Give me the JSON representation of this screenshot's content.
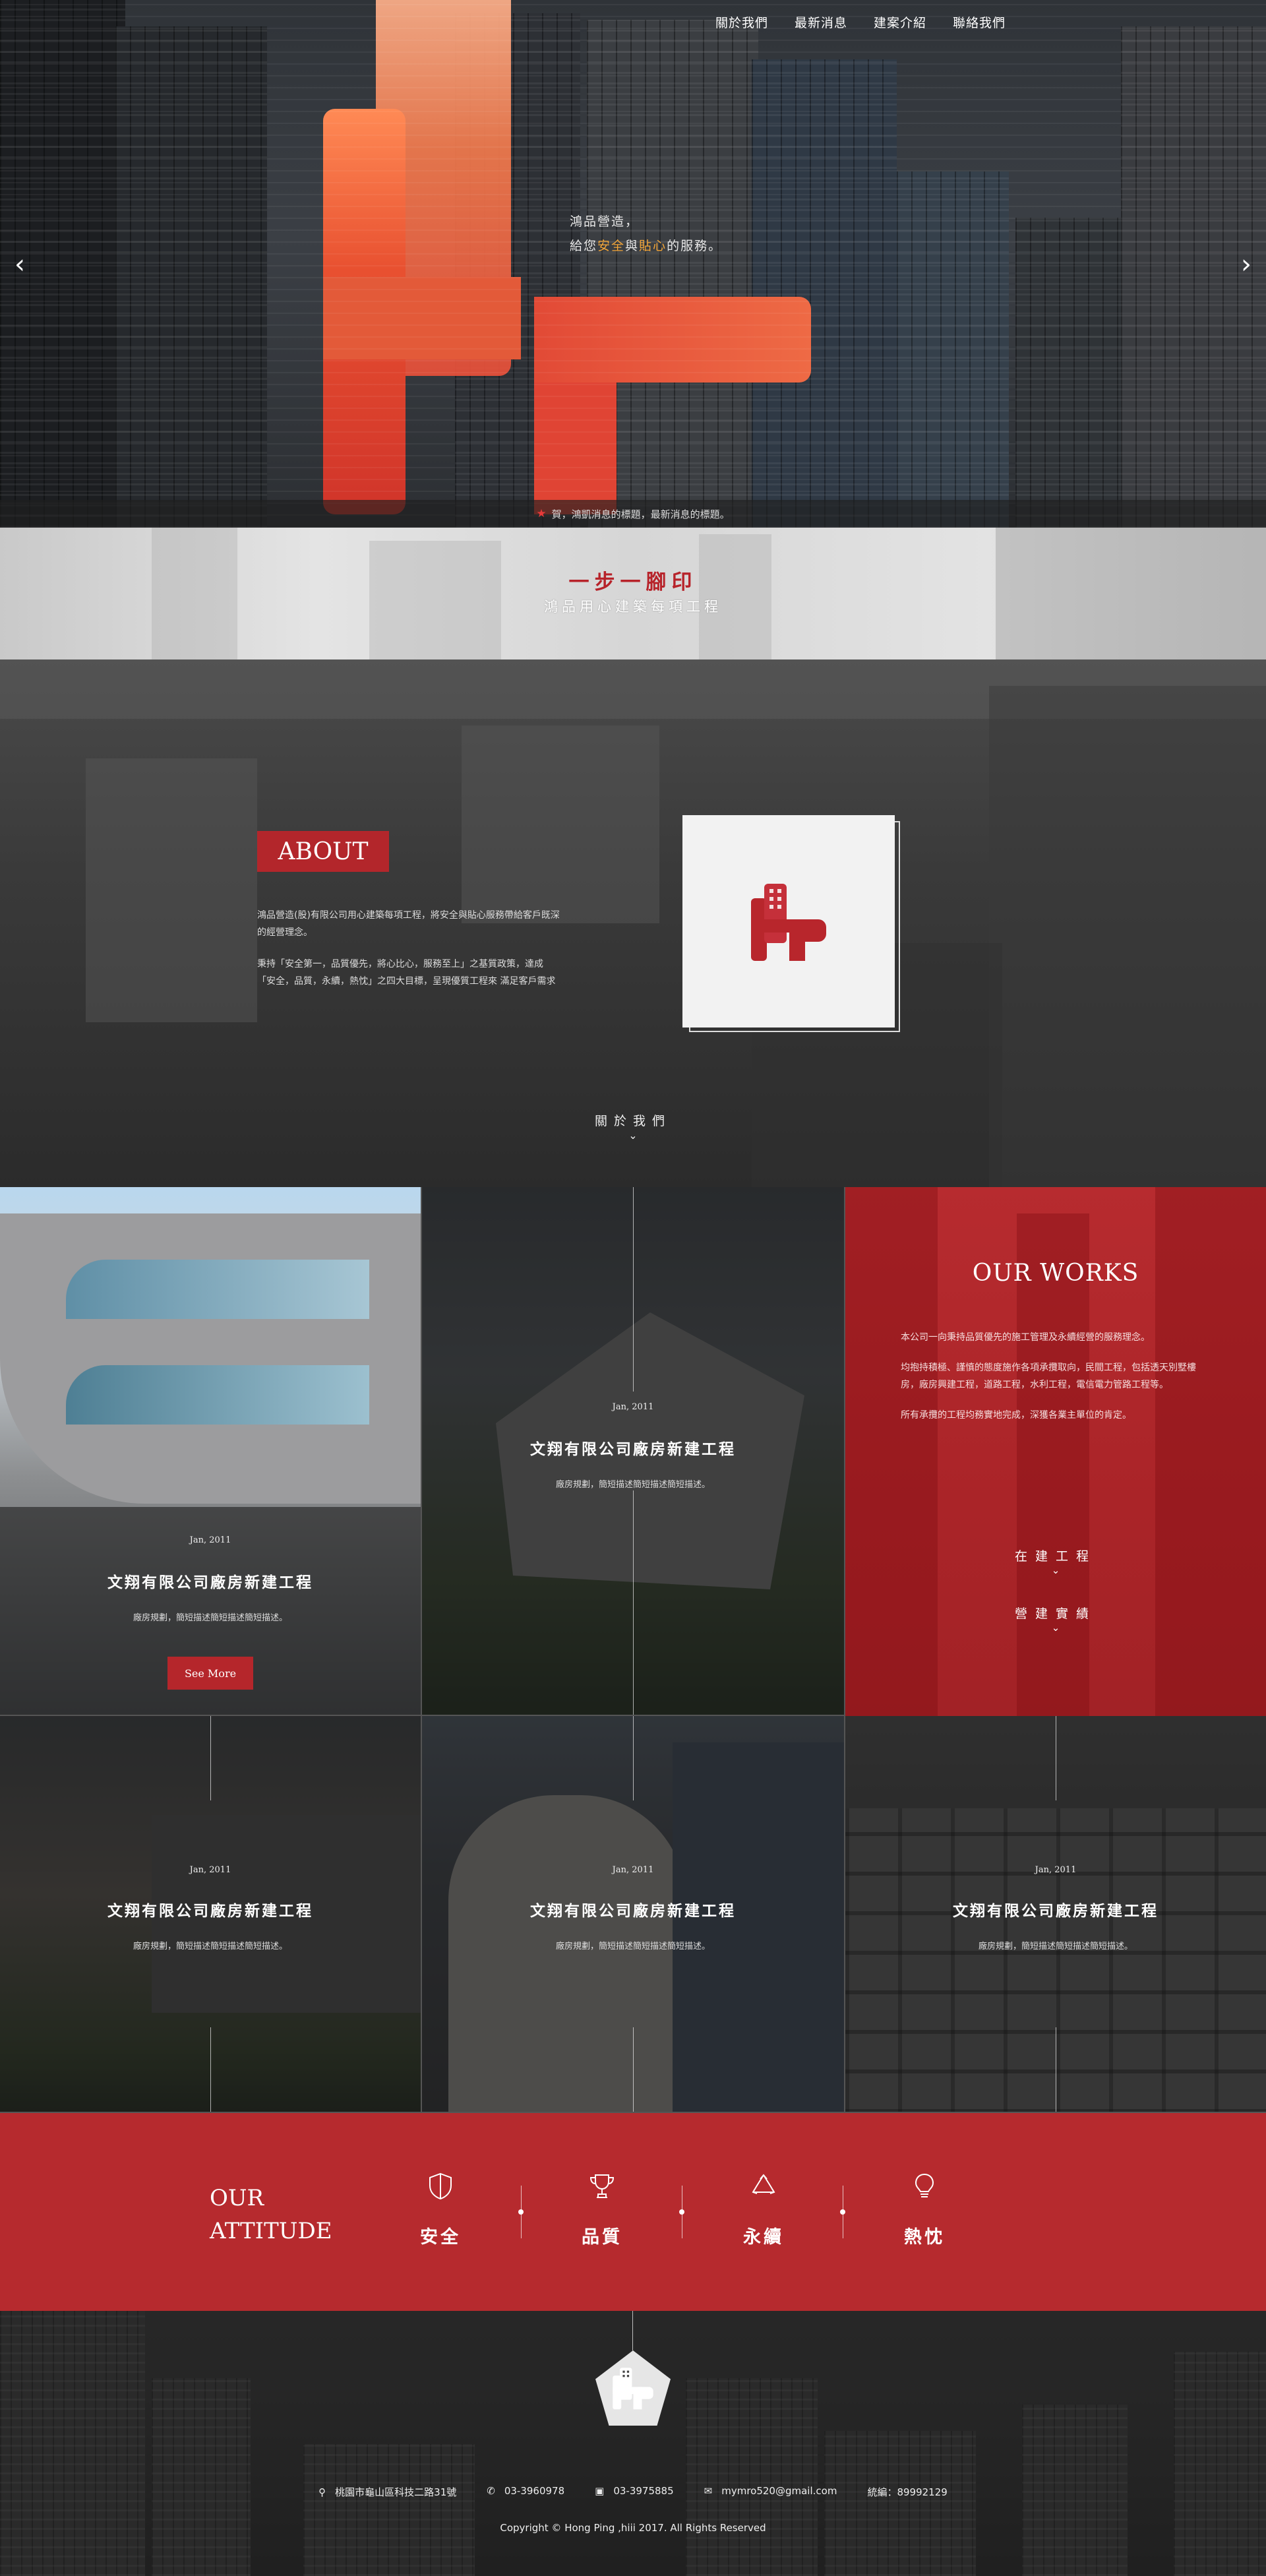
{
  "nav": {
    "items": [
      "關於我們",
      "最新消息",
      "建案介紹",
      "聯絡我們"
    ],
    "prev_arrow": "‹",
    "next_arrow": "›"
  },
  "hero": {
    "tagline_line1": "鴻品營造，",
    "tagline_line2_a": "給您",
    "tagline_line2_safe": "安全",
    "tagline_line2_and": "與",
    "tagline_line2_care": "貼心",
    "tagline_line2_b": "的服務。",
    "news": "賀，鴻凱消息的標題，最新消息的標題。",
    "highlight_color": "#f3a63a"
  },
  "step": {
    "title": "一步一腳印",
    "subtitle": "鴻品用心建築每項工程"
  },
  "about": {
    "badge": "ABOUT",
    "para1": "鴻品營造(股)有限公司用心建築每項工程，將安全與貼心服務帶給客戶既深的經營理念。",
    "para2": "秉持「安全第一，品質優先，將心比心，服務至上」之基質政策，達成「安全，品質，永續，熱忱」之四大目標，呈現優質工程來 滿足客戶需求",
    "more": "關於我們",
    "chevron": "⌄"
  },
  "works": {
    "items": [
      {
        "date": "Jan, 2011",
        "title": "文翔有限公司廠房新建工程",
        "desc": "廠房規劃，簡短描述簡短描述簡短描述。",
        "button": "See More"
      },
      {
        "date": "Jan, 2011",
        "title": "文翔有限公司廠房新建工程",
        "desc": "廠房規劃，簡短描述簡短描述簡短描述。"
      },
      {
        "date": "Jan, 2011",
        "title": "文翔有限公司廠房新建工程",
        "desc": "廠房規劃，簡短描述簡短描述簡短描述。"
      },
      {
        "date": "Jan, 2011",
        "title": "文翔有限公司廠房新建工程",
        "desc": "廠房規劃，簡短描述簡短描述簡短描述。"
      },
      {
        "date": "Jan, 2011",
        "title": "文翔有限公司廠房新建工程",
        "desc": "廠房規劃，簡短描述簡短描述簡短描述。"
      }
    ],
    "our_works": {
      "title": "OUR WORKS",
      "para1": "本公司一向秉持品質優先的施工管理及永續經營的服務理念。",
      "para2": "均抱持積極、謹慎的態度施作各項承攬取向，民間工程，包括透天別墅樓房，廠房興建工程，道路工程，水利工程，電信電力管路工程等。",
      "para3": "所有承攬的工程均務實地完成，深獲各業主單位的肯定。",
      "link1": "在建工程",
      "link2": "營建實績",
      "chevron": "⌄",
      "color": "#b72b2f"
    }
  },
  "attitude": {
    "title_line1": "OUR",
    "title_line2": "ATTITUDE",
    "items": [
      {
        "label": "安全",
        "icon": "shield-icon"
      },
      {
        "label": "品質",
        "icon": "trophy-icon"
      },
      {
        "label": "永續",
        "icon": "recycle-icon"
      },
      {
        "label": "熱忱",
        "icon": "lightbulb-icon"
      }
    ],
    "color": "#b62a2e"
  },
  "footer": {
    "address": "桃園市龜山區科技二路31號",
    "phone": "03-3960978",
    "fax": "03-3975885",
    "email": "mymro520@gmail.com",
    "tax_id": "統編：89992129",
    "copyright": "Copyright © Hong Ping ,hiii 2017. All Rights Reserved"
  }
}
